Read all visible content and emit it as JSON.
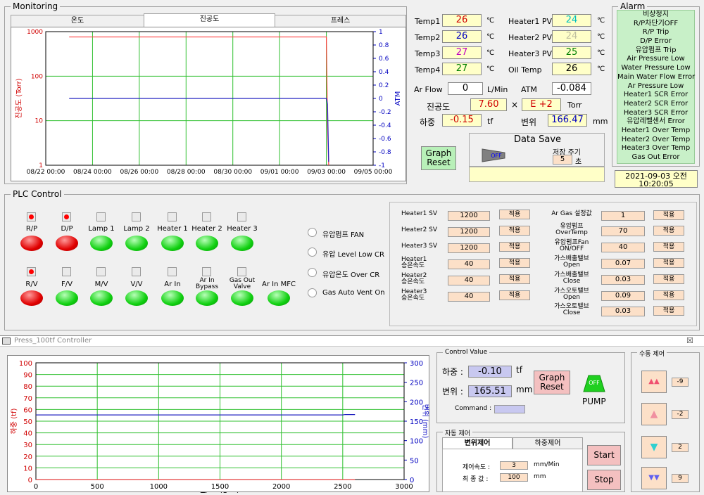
{
  "monitoring": {
    "title": "Monitoring",
    "tabs": [
      "온도",
      "진공도",
      "프레스"
    ],
    "active_tab": 1,
    "chart_data": {
      "type": "line",
      "ylabel_left": "진공도 (Torr)",
      "ylabel_right": "ATM",
      "y_left_ticks": [
        "1000",
        "100",
        "10",
        "1"
      ],
      "y_right_ticks": [
        "1",
        "0.8",
        "0.6",
        "0.4",
        "0.2",
        "0",
        "-0.2",
        "-0.4",
        "-0.6",
        "-0.8",
        "-1"
      ],
      "x_ticks": [
        "08/22 00:00",
        "08/24 00:00",
        "08/26 00:00",
        "08/28 00:00",
        "08/30 00:00",
        "09/01 00:00",
        "09/03 00:00",
        "09/05 00:00"
      ],
      "series": [
        {
          "color": "#ff4040",
          "axis": "left",
          "x": [
            1.0,
            12.0,
            12.05,
            12.1
          ],
          "y": [
            760,
            760,
            7.6,
            1.0
          ]
        },
        {
          "color": "#2020c0",
          "axis": "right",
          "x": [
            1.0,
            12.0,
            12.05,
            12.1
          ],
          "y": [
            0,
            0,
            -0.084,
            -0.95
          ]
        }
      ],
      "grid": true
    }
  },
  "readings": {
    "temp_labels": [
      "Temp1",
      "Temp2",
      "Temp3",
      "Temp4"
    ],
    "temp_values": [
      "26",
      "26",
      "27",
      "27"
    ],
    "temp_colors": [
      "#d00000",
      "#0000c0",
      "#c000c0",
      "#008000"
    ],
    "heater_labels": [
      "Heater1 PV",
      "Heater2 PV",
      "Heater3 PV",
      "Oil Temp"
    ],
    "heater_values": [
      "24",
      "24",
      "25",
      "26"
    ],
    "heater_colors": [
      "#00c0c0",
      "#c0c0a0",
      "#008000",
      "#000000"
    ],
    "unit_c": "℃",
    "ar_flow_label": "Ar Flow",
    "ar_flow_value": "0",
    "ar_flow_unit": "L/Min",
    "atm_label": "ATM",
    "atm_value": "-0.084",
    "vacuum_label": "진공도",
    "vacuum_mantissa": "7.60",
    "vacuum_times": "×",
    "vacuum_exp": "E +2",
    "vacuum_unit": "Torr",
    "load_label": "하중",
    "load_value": "-0.15",
    "load_unit": "tf",
    "disp_label": "변위",
    "disp_value": "166.47",
    "disp_unit": "mm",
    "graph_reset": "Graph\nReset",
    "data_save_title": "Data Save",
    "toggle_off": "OFF",
    "save_period_label": "저장 주기",
    "save_period_value": "5",
    "save_period_unit": "초"
  },
  "alarm": {
    "title": "Alarm",
    "items": [
      "비상정지",
      "R/P차단기OFF",
      "R/P Trip",
      "D/P Error",
      "유압펌프 Trip",
      "Air Pressure Low",
      "Water Pressure Low",
      "Main Water Flow Error",
      "Ar Pressure Low",
      "Heater1 SCR Error",
      "Heater2 SCR Error",
      "Heater3 SCR Error",
      "유압레벨센서 Error",
      "Heater1 Over Temp",
      "Heater2 Over Temp",
      "Heater3 Over Temp",
      "Gas Out Error"
    ],
    "datetime_line1": "2021-09-03 오전",
    "datetime_line2": "10:20:05"
  },
  "plc": {
    "title": "PLC Control",
    "row1": [
      {
        "label": "R/P",
        "on": true,
        "color": "red"
      },
      {
        "label": "D/P",
        "on": true,
        "color": "red"
      },
      {
        "label": "Lamp 1",
        "on": false,
        "color": "green"
      },
      {
        "label": "Lamp 2",
        "on": false,
        "color": "green"
      },
      {
        "label": "Heater 1",
        "on": false,
        "color": "green"
      },
      {
        "label": "Heater 2",
        "on": false,
        "color": "green"
      },
      {
        "label": "Heater 3",
        "on": false,
        "color": "green"
      }
    ],
    "row2": [
      {
        "label": "R/V",
        "on": true,
        "color": "red"
      },
      {
        "label": "F/V",
        "on": false,
        "color": "green"
      },
      {
        "label": "M/V",
        "on": false,
        "color": "green"
      },
      {
        "label": "V/V",
        "on": false,
        "color": "green"
      },
      {
        "label": "Ar In",
        "on": false,
        "color": "green"
      },
      {
        "label": "Ar In\nBypass",
        "on": false,
        "color": "green"
      },
      {
        "label": "Gas Out\nValve",
        "on": false,
        "color": "green"
      },
      {
        "label": "Ar In MFC",
        "on": false,
        "color": "green",
        "no_indicator": true
      }
    ],
    "radios": [
      "유압펌프 FAN",
      "유압 Level Low CR",
      "유압온도 Over CR",
      "Gas Auto Vent On"
    ]
  },
  "settings": {
    "apply_label": "적용",
    "left": [
      {
        "label": "Heater1 SV",
        "value": "1200"
      },
      {
        "label": "Heater2 SV",
        "value": "1200"
      },
      {
        "label": "Heater3 SV",
        "value": "1200"
      },
      {
        "label": "Heater1\n승온속도",
        "value": "40"
      },
      {
        "label": "Heater2\n승온속도",
        "value": "40"
      },
      {
        "label": "Heater3\n승온속도",
        "value": "40"
      }
    ],
    "right": [
      {
        "label": "Ar Gas 설정값",
        "value": "1"
      },
      {
        "label": "유압펌프\nOverTemp",
        "value": "70"
      },
      {
        "label": "유압펌프Fan\nON/OFF",
        "value": "40"
      },
      {
        "label": "가스배출밸브\nOpen",
        "value": "0.07"
      },
      {
        "label": "가스배출밸브\nClose",
        "value": "0.03"
      },
      {
        "label": "가스오토밸브\nOpen",
        "value": "0.09"
      },
      {
        "label": "가스오토밸브\nClose",
        "value": "0.03"
      }
    ]
  },
  "press": {
    "window_title": "Press_100tf Controller",
    "close_x": "☒",
    "chart_data": {
      "type": "line",
      "ylabel_left": "하중 (tf)",
      "ylabel_right": "변위 (mm)",
      "xlabel": "Time(Sec)",
      "y_left_ticks": [
        "100",
        "90",
        "80",
        "70",
        "60",
        "50",
        "40",
        "30",
        "20",
        "10",
        "0"
      ],
      "y_right_ticks": [
        "300",
        "250",
        "200",
        "150",
        "100",
        "50",
        "0"
      ],
      "x_ticks": [
        "0",
        "500",
        "1000",
        "1500",
        "2000",
        "2500",
        "3000"
      ],
      "series": [
        {
          "color": "#2020c0",
          "axis": "right",
          "x": [
            0,
            2500,
            2520,
            2600
          ],
          "y": [
            166,
            166,
            167,
            167
          ]
        },
        {
          "color": "#ff4040",
          "axis": "left",
          "x": [
            0,
            2600
          ],
          "y": [
            -0.1,
            -0.1
          ]
        }
      ],
      "grid": true
    },
    "control_value_title": "Control Value",
    "load_label": "하중 :",
    "load_value": "-0.10",
    "load_unit": "tf",
    "disp_label": "변위 :",
    "disp_value": "165.51",
    "disp_unit": "mm",
    "command_label": "Command :",
    "command_value": "",
    "graph_reset": "Graph\nReset",
    "pump_state": "OFF",
    "pump_label": "PUMP",
    "auto_title": "자동 제어",
    "auto_tabs": [
      "변위제어",
      "하중제어"
    ],
    "speed_label": "제어속도 :",
    "speed_value": "3",
    "speed_unit": "mm/Min",
    "final_label": "최 종 값 :",
    "final_value": "100",
    "final_unit": "mm",
    "start": "Start",
    "stop": "Stop",
    "manual_title": "수동 제어",
    "manual_values": [
      "-9",
      "-2",
      "2",
      "9"
    ]
  }
}
